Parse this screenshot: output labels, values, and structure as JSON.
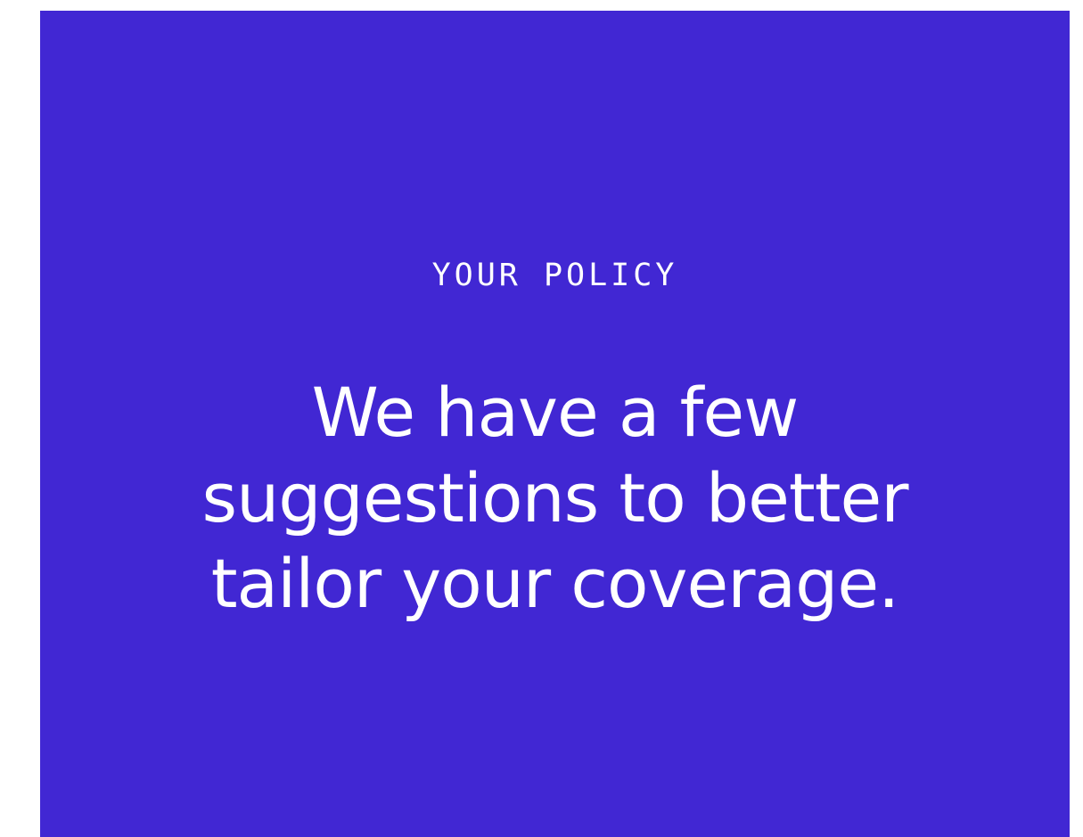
{
  "colors": {
    "panel_background": "#4127d3",
    "text": "#ffffff",
    "page_background": "#ffffff"
  },
  "hero": {
    "eyebrow": "YOUR POLICY",
    "headline_lines": [
      "We have a few",
      "suggestions to better",
      "tailor your coverage."
    ]
  }
}
